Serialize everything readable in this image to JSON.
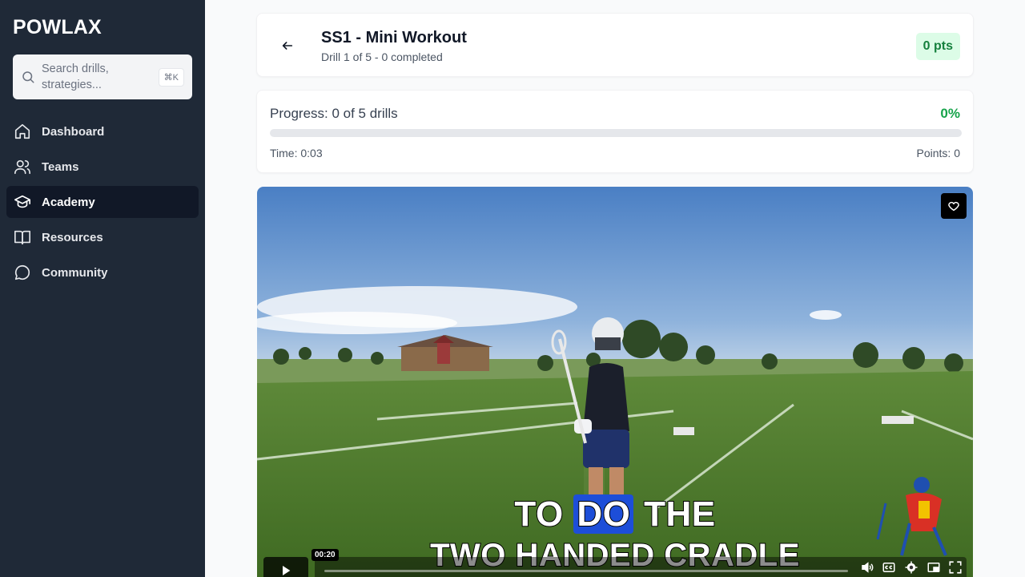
{
  "sidebar": {
    "brand": "POWLAX",
    "search": {
      "placeholder": "Search drills, strategies...",
      "shortcut": "⌘K"
    },
    "items": [
      {
        "label": "Dashboard",
        "icon": "home-icon",
        "active": false
      },
      {
        "label": "Teams",
        "icon": "users-icon",
        "active": false
      },
      {
        "label": "Academy",
        "icon": "graduation-cap-icon",
        "active": true
      },
      {
        "label": "Resources",
        "icon": "book-open-icon",
        "active": false
      },
      {
        "label": "Community",
        "icon": "message-circle-icon",
        "active": false
      }
    ]
  },
  "header": {
    "title": "SS1 - Mini Workout",
    "subtitle": "Drill 1 of 5 - 0 completed",
    "points_badge": "0 pts",
    "back_icon": "arrow-left-icon"
  },
  "progress": {
    "label": "Progress: 0 of 5 drills",
    "percent_text": "0%",
    "percent": 0,
    "time": "Time: 0:03",
    "points": "Points: 0"
  },
  "video": {
    "caption_line1_before": "TO",
    "caption_line1_highlight": "DO",
    "caption_line1_after": "THE",
    "caption_line2": "TWO HANDED CRADLE",
    "current_time": "00:20",
    "favorite_icon": "heart-icon",
    "controls": [
      "play-icon",
      "volume-icon",
      "captions-icon",
      "settings-icon",
      "pip-icon",
      "fullscreen-icon"
    ]
  },
  "colors": {
    "sidebar_bg": "#1f2937",
    "active_item_bg": "#111827",
    "accent_green": "#16a34a",
    "badge_bg": "#dcfce7"
  }
}
